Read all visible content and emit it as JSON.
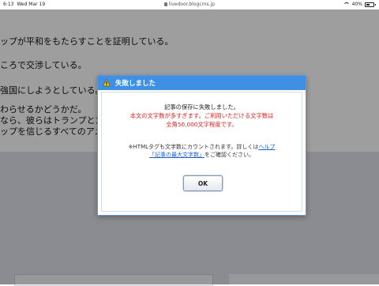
{
  "status_bar": {
    "time": "6:13",
    "date": "Wed Mar 19",
    "url": "livedoor.blogcms.jp",
    "battery": "40%"
  },
  "background": {
    "lines": [
      "ップが平和をもたらすことを証明している。",
      "ころで交渉している。",
      "強国にしようとしている。",
      "わらせるかどうかだ。",
      "なら、彼らはトランプとた",
      "ップを信じるすべてのアメ"
    ]
  },
  "dialog": {
    "title": "失敗しました",
    "message_line1": "記事の保存に失敗しました。",
    "error_line1": "本文の文字数が多すぎます。ご利用いただける文字数は",
    "error_line2": "全角50,000文字程度です。",
    "note_prefix": "※HTMLタグも文字数にカウントされます。詳しくは",
    "help_link": "ヘルプ",
    "max_link": "「記事の最大文字数」",
    "note_suffix": "をご確認ください。",
    "ok_label": "OK"
  },
  "colors": {
    "header_blue": "#3f8fe4",
    "error_red": "#e02020",
    "link_blue": "#1a5fc9"
  }
}
